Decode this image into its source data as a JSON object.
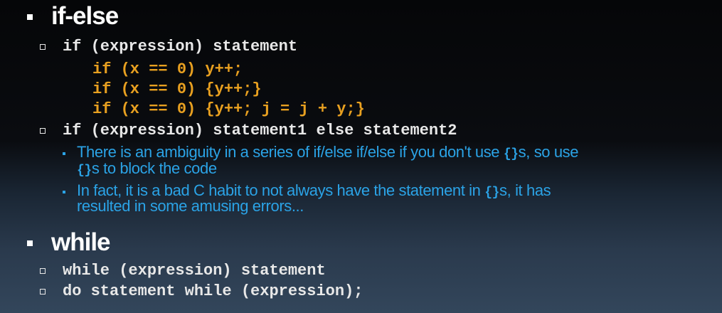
{
  "section1": {
    "heading": "if-else",
    "line1": "if (expression) statement",
    "code": [
      "if (x == 0) y++;",
      "if (x == 0) {y++;}",
      "if (x == 0) {y++; j = j + y;}"
    ],
    "line2": "if (expression) statement1 else statement2",
    "bullet_a": {
      "part1": "There is an ambiguity in a series of if/else if/else if you don't use ",
      "braces1": "{}",
      "part2": "s, so use",
      "braces2": "{}",
      "part3": "s to block the code"
    },
    "bullet_b": {
      "part1": "In fact, it is a bad C habit to not always have the statement in ",
      "braces": "{}",
      "part2": "s, it has",
      "line2": "resulted in some amusing errors..."
    }
  },
  "section2": {
    "heading": "while",
    "lines": [
      "while (expression) statement",
      "do statement while (expression);"
    ]
  },
  "colors": {
    "heading": "#ffffff",
    "code": "#e8a020",
    "body_text": "#2ba3e6",
    "mono_text": "#e8e8e8"
  }
}
